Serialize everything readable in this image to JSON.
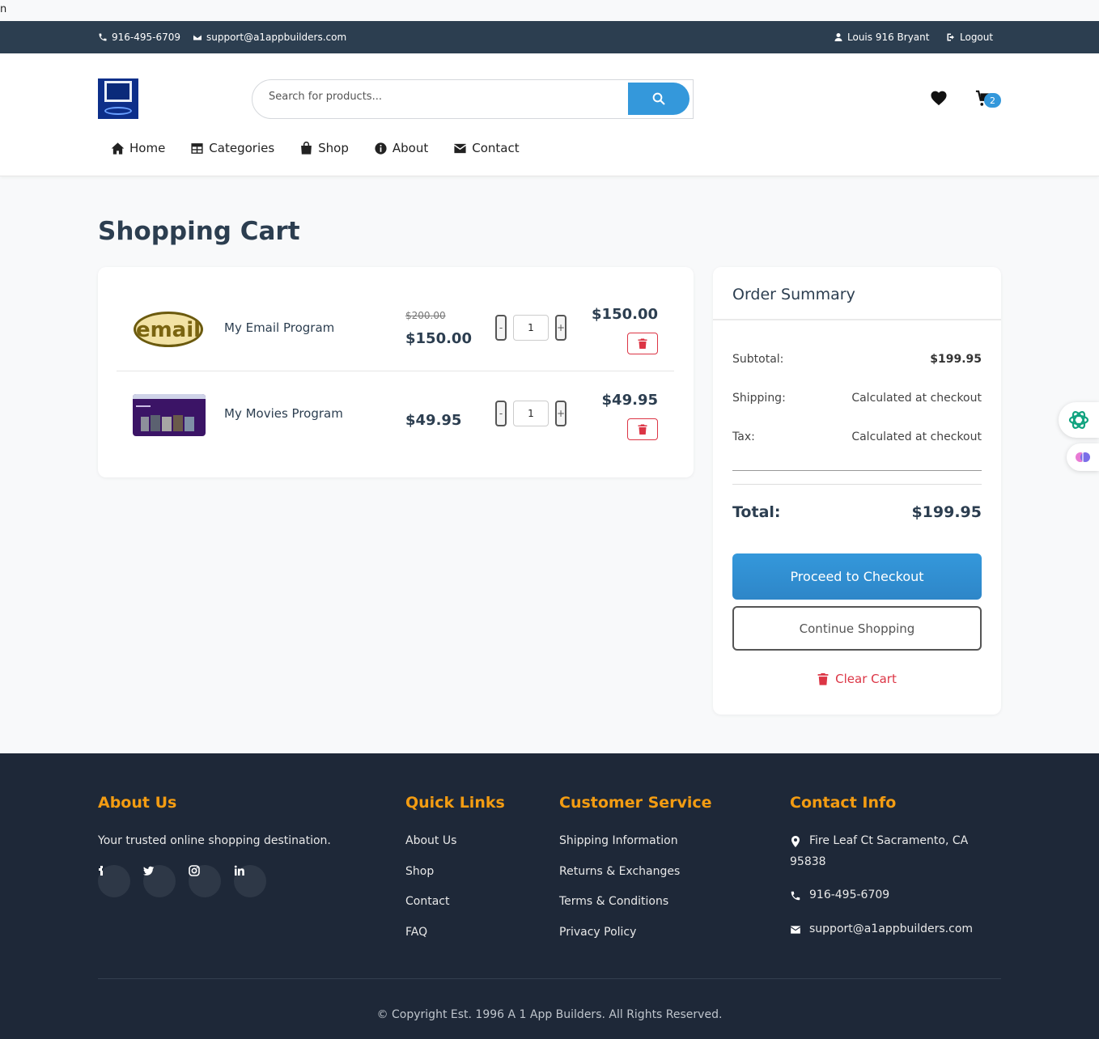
{
  "stray_char": "n",
  "topbar": {
    "phone": "916-495-6709",
    "email": "support@a1appbuilders.com",
    "user": "Louis 916 Bryant",
    "logout": "Logout"
  },
  "search": {
    "placeholder": "Search for products..."
  },
  "cart_badge": "2",
  "nav": {
    "home": "Home",
    "categories": "Categories",
    "shop": "Shop",
    "about": "About",
    "contact": "Contact"
  },
  "page_title": "Shopping Cart",
  "cart_items": [
    {
      "name": "My Email Program",
      "old_price": "$200.00",
      "price": "$150.00",
      "qty": "1",
      "line_total": "$150.00"
    },
    {
      "name": "My Movies Program",
      "old_price": "",
      "price": "$49.95",
      "qty": "1",
      "line_total": "$49.95"
    }
  ],
  "qty_controls": {
    "minus": "-",
    "plus": "+"
  },
  "thumb_text": "email",
  "summary": {
    "title": "Order Summary",
    "subtotal_label": "Subtotal:",
    "subtotal_value": "$199.95",
    "shipping_label": "Shipping:",
    "shipping_value": "Calculated at checkout",
    "tax_label": "Tax:",
    "tax_value": "Calculated at checkout",
    "total_label": "Total:",
    "total_value": "$199.95",
    "checkout": "Proceed to Checkout",
    "continue": "Continue Shopping",
    "clear": "Clear Cart"
  },
  "footer": {
    "about_title": "About Us",
    "about_text": "Your trusted online shopping destination.",
    "quick_title": "Quick Links",
    "quick_links": [
      "About Us",
      "Shop",
      "Contact",
      "FAQ"
    ],
    "service_title": "Customer Service",
    "service_links": [
      "Shipping Information",
      "Returns & Exchanges",
      "Terms & Conditions",
      "Privacy Policy"
    ],
    "contact_title": "Contact Info",
    "address_line1": "Fire Leaf Ct Sacramento, CA",
    "address_line2": "95838",
    "phone": "916-495-6709",
    "email": "support@a1appbuilders.com",
    "copyright": "© Copyright Est. 1996 A 1 App Builders. All Rights Reserved."
  },
  "colors": {
    "topbar": "#2c3e50",
    "accent": "#3498db",
    "danger": "#dc3545",
    "footer": "#1e2838",
    "footer_heading": "#f39c12"
  }
}
